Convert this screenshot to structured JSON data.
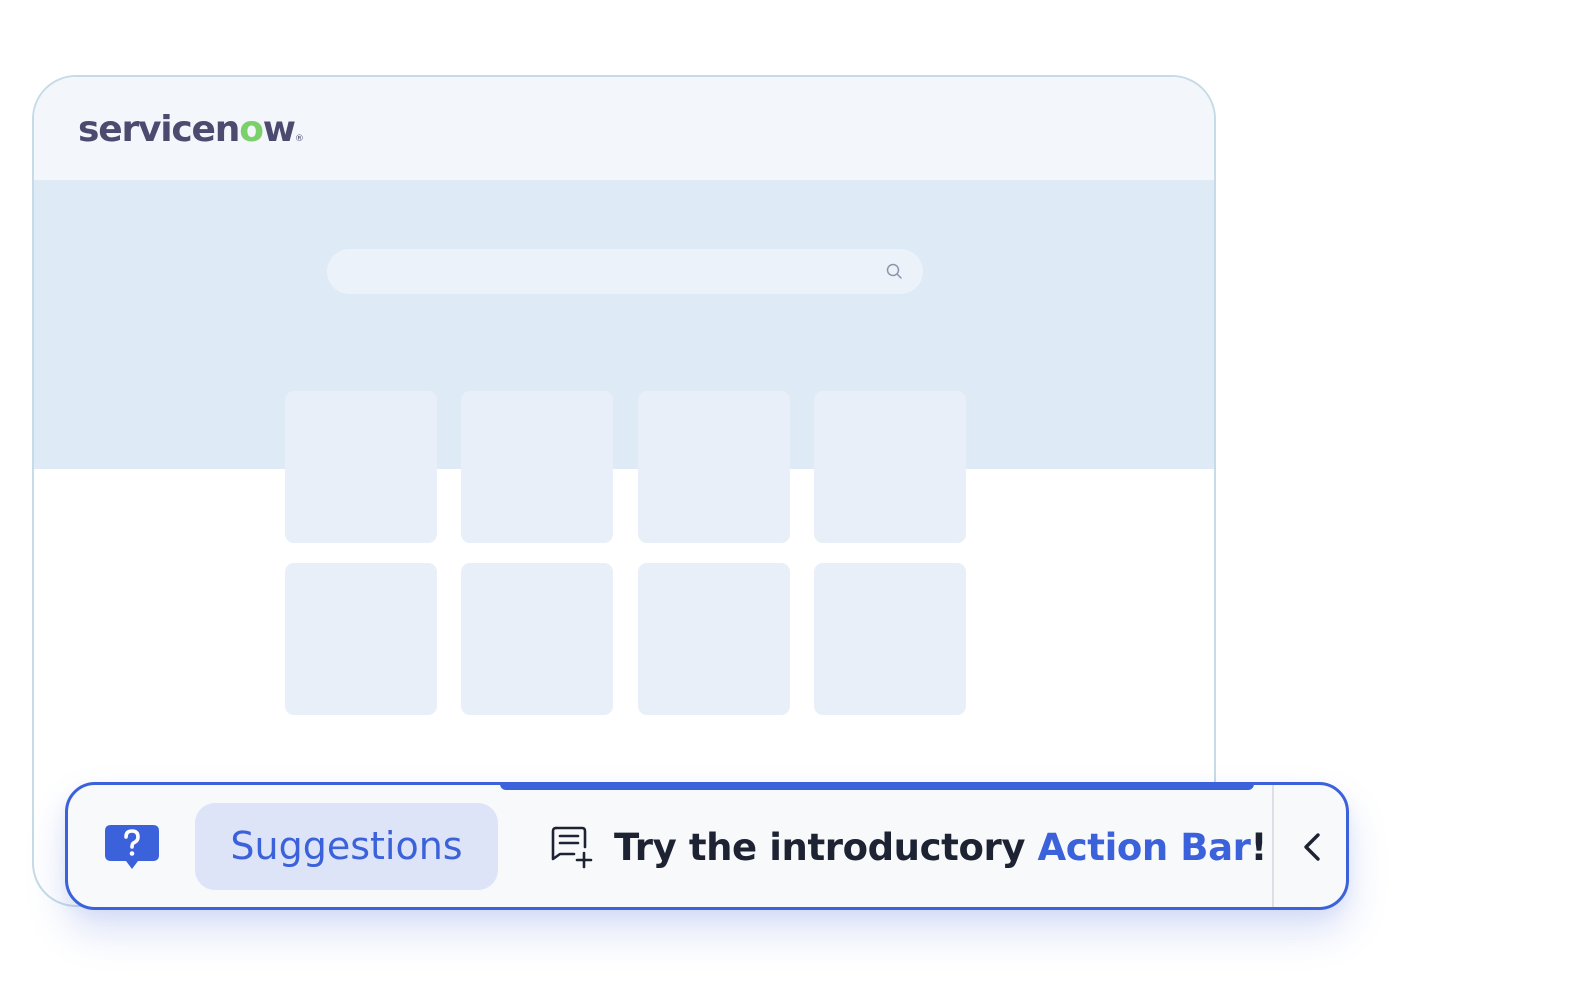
{
  "app": {
    "logo_text_main": "servicen",
    "logo_text_o": "o",
    "logo_text_end": "w",
    "logo_registered": "®"
  },
  "search": {
    "placeholder": "",
    "icon": "search-icon"
  },
  "action_bar": {
    "help_icon": "question-bubble-icon",
    "suggestions_label": "Suggestions",
    "promo_icon": "note-add-icon",
    "promo_prefix": "Try the introductory ",
    "promo_highlight": "Action Bar",
    "promo_suffix": "!",
    "collapse_icon": "chevron-left-icon",
    "progress": 0.6
  },
  "colors": {
    "accent": "#3b62da",
    "logo_text": "#4d4a70",
    "logo_accent": "#7cd06b",
    "hero_bg": "#deeaf6",
    "tile_bg": "#e8eff8"
  }
}
